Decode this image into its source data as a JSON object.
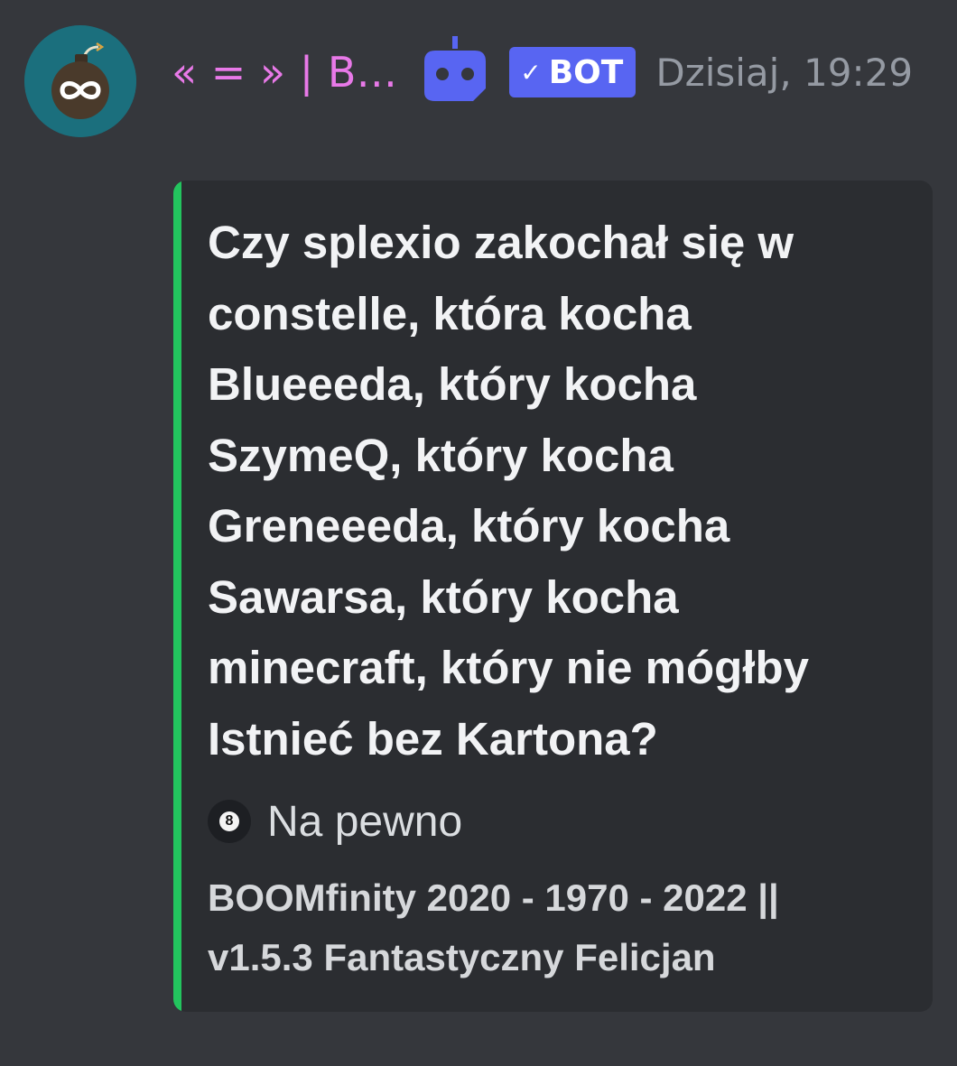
{
  "message": {
    "username": "« = » | B...",
    "bot_badge": {
      "check": "✓",
      "label": "BOT"
    },
    "timestamp": "Dzisiaj, 19:29",
    "avatar_icon": "bomb-infinity-icon",
    "app_icon": "robot-icon"
  },
  "embed": {
    "accent_color": "#23c45e",
    "title": "Czy splexio zakochał się w\nconstelle, która kocha\nBlueeeda, który kocha\nSzymeQ, który kocha\nGreneeeda, który kocha\nSawarsa, który kocha\nminecraft, który nie mógłby\nIstnieć bez Kartona?",
    "field": {
      "icon": "eight-ball-icon",
      "icon_text": "8",
      "value": "Na pewno"
    },
    "footer": "BOOMfinity 2020 - 1970 - 2022 ||\nv1.5.3 Fantastyczny Felicjan"
  },
  "colors": {
    "background": "#35373c",
    "embed_background": "#2b2d31",
    "username": "#e879e8",
    "badge": "#5865f2",
    "timestamp": "#959aa3"
  }
}
